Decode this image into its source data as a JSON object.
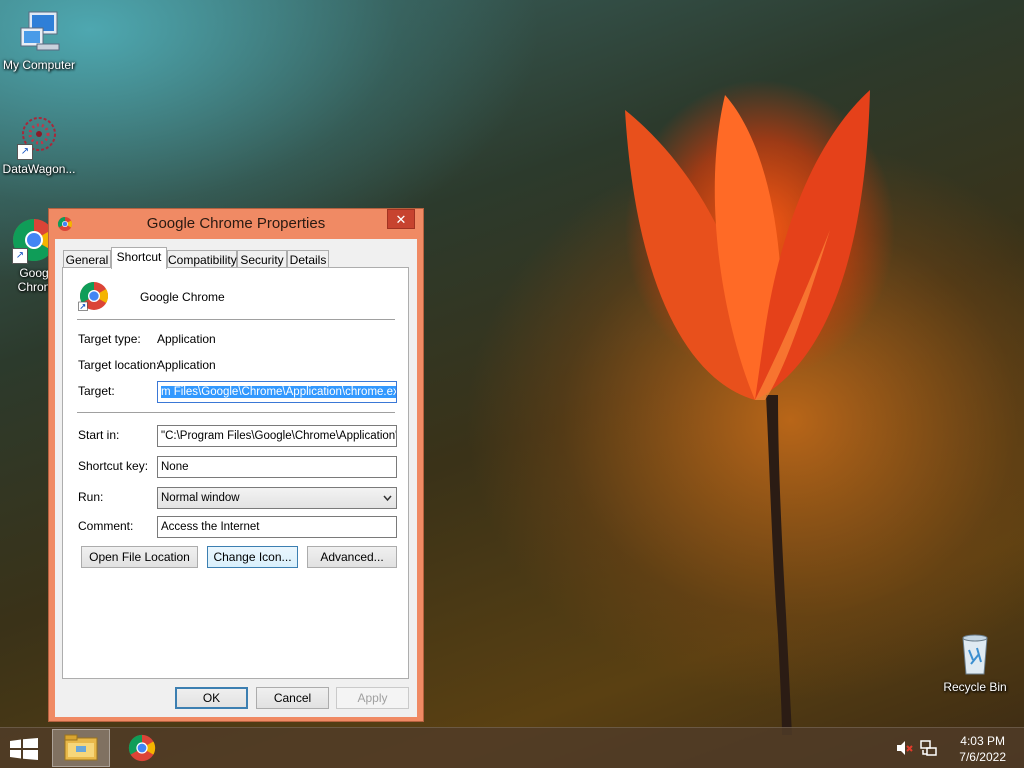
{
  "desktop": {
    "icons": [
      {
        "label": "My Computer",
        "icon": "computer-icon"
      },
      {
        "label": "DataWagon...",
        "icon": "datawagon-icon"
      },
      {
        "label": "Goog",
        "label2": "Chron",
        "icon": "chrome-icon"
      },
      {
        "label": "Recycle Bin",
        "icon": "recycle-bin-icon"
      }
    ]
  },
  "dialog": {
    "title": "Google Chrome Properties",
    "close_label": "✕",
    "tabs": [
      "General",
      "Shortcut",
      "Compatibility",
      "Security",
      "Details"
    ],
    "active_tab": "Shortcut",
    "app_name": "Google Chrome",
    "target_type_label": "Target type:",
    "target_type": "Application",
    "target_location_label": "Target location:",
    "target_location": "Application",
    "target_label": "Target:",
    "target_value": "m Files\\Google\\Chrome\\Application\\chrome.exe\"",
    "start_in_label": "Start in:",
    "start_in_value": "\"C:\\Program Files\\Google\\Chrome\\Application\"",
    "shortcut_key_label": "Shortcut key:",
    "shortcut_key_value": "None",
    "run_label": "Run:",
    "run_value": "Normal window",
    "comment_label": "Comment:",
    "comment_value": "Access the Internet",
    "open_file_location": "Open File Location",
    "change_icon": "Change Icon...",
    "advanced": "Advanced...",
    "ok": "OK",
    "cancel": "Cancel",
    "apply": "Apply"
  },
  "taskbar": {
    "time": "4:03 PM",
    "date": "7/6/2022",
    "items": [
      "file-explorer-icon",
      "chrome-icon"
    ]
  },
  "colors": {
    "window_frame": "#f08a64",
    "close_button": "#c7432f",
    "selection": "#3399ff"
  }
}
